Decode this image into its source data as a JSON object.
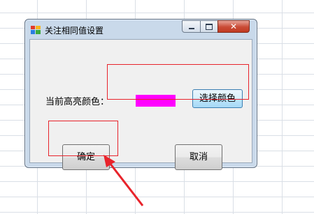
{
  "dialog": {
    "title": "关注相同值设置",
    "controls": {
      "minimize_icon": "minimize-icon",
      "maximize_icon": "maximize-icon",
      "close_glyph": "✕"
    },
    "highlight_label": "当前高亮颜色：",
    "highlight_color": "#ff00ff",
    "choose_color_button": "选择颜色",
    "ok_button": "确定",
    "cancel_button": "取消"
  },
  "colors": {
    "annotation": "#e8232b",
    "titlebar": "#c9d9ea",
    "close_button": "#c94b35"
  }
}
